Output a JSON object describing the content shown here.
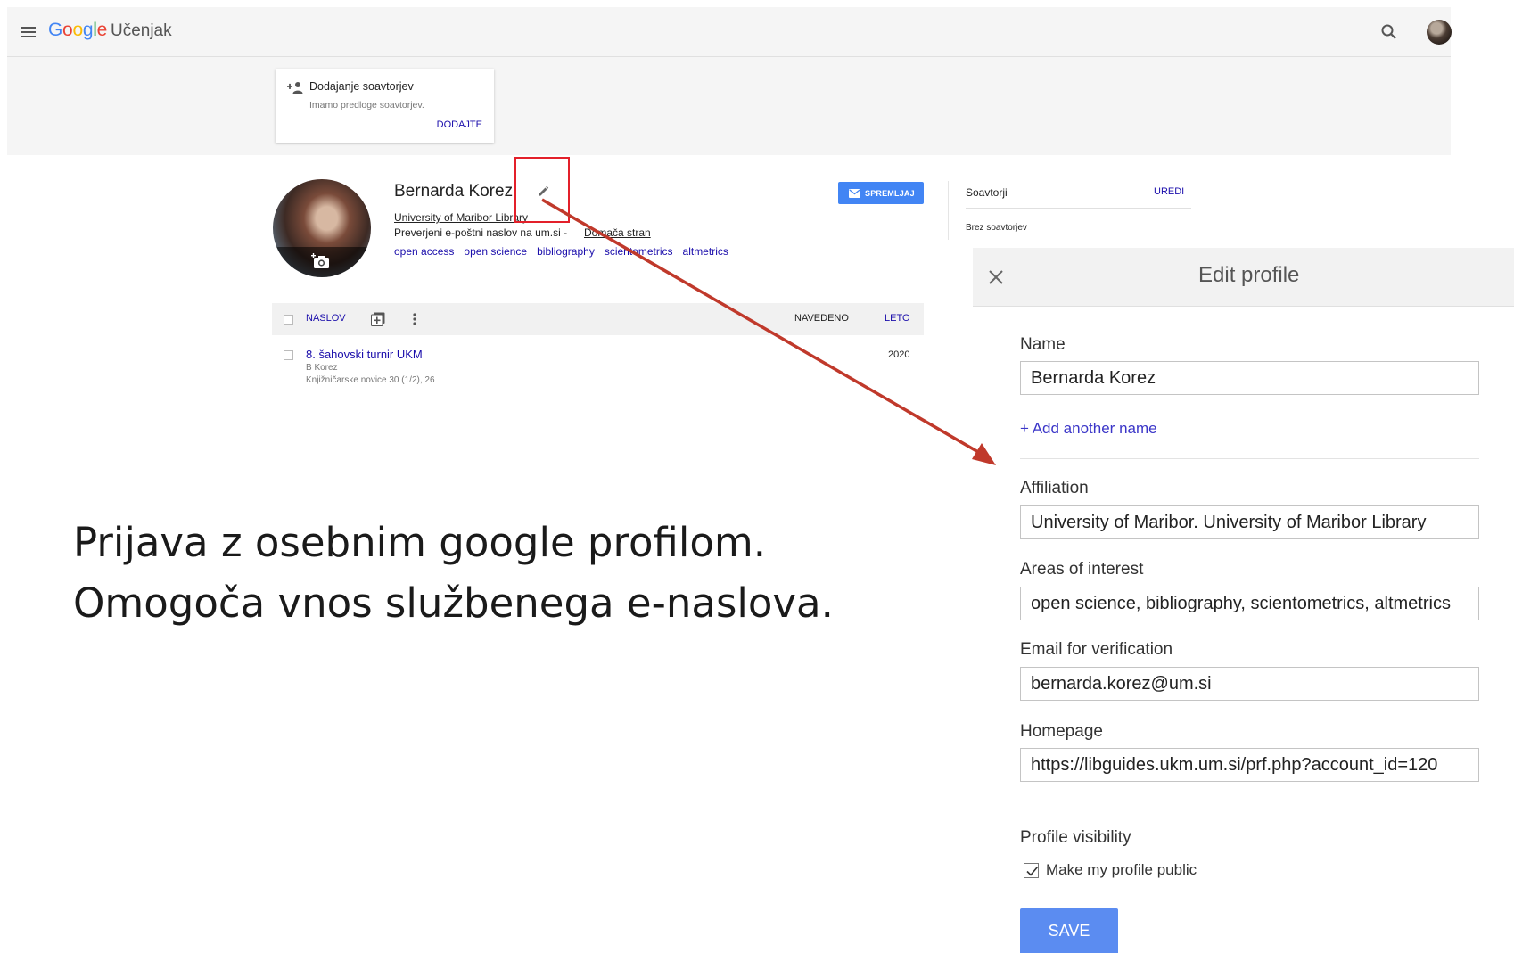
{
  "topbar": {
    "logo_google": [
      "G",
      "o",
      "o",
      "g",
      "l",
      "e"
    ],
    "app_name": "Učenjak",
    "menu_icon": "hamburger-menu-icon",
    "search_icon": "search-icon",
    "account_icon": "account-avatar"
  },
  "coauthor_card": {
    "icon": "add-person-icon",
    "title": "Dodajanje soavtorjev",
    "subtitle": "Imamo predloge soavtorjev.",
    "action": "DODAJTE"
  },
  "profile": {
    "name": "Bernarda Korez",
    "affiliation": "University of Maribor Library",
    "verified_email": "Preverjeni e-poštni naslov na um.si - ",
    "homepage_link": "Domača stran",
    "interests": [
      "open access",
      "open science",
      "bibliography",
      "scientometrics",
      "altmetrics"
    ],
    "follow_label": "SPREMLJAJ"
  },
  "coauthors": {
    "title": "Soavtorji",
    "edit_label": "UREDI",
    "empty_text": "Brez soavtorjev"
  },
  "articles": {
    "columns": {
      "title": "NASLOV",
      "cited": "NAVEDENO",
      "year": "LETO"
    },
    "rows": [
      {
        "title": "8. šahovski turnir UKM",
        "authors": "B Korez",
        "source": "Knjižničarske novice 30 (1/2), 26",
        "year": "2020"
      }
    ]
  },
  "caption": {
    "line1": "Prijava z osebnim google profilom.",
    "line2": "Omogoča vnos službenega e-naslova."
  },
  "edit_profile": {
    "title": "Edit profile",
    "name_label": "Name",
    "name_value": "Bernarda Korez",
    "add_name": "+ Add another name",
    "affiliation_label": "Affiliation",
    "affiliation_value": "University of Maribor. University of Maribor Library",
    "interests_label": "Areas of interest",
    "interests_value": "open science, bibliography, scientometrics, altmetrics",
    "email_label": "Email for verification",
    "email_value": "bernarda.korez@um.si",
    "homepage_label": "Homepage",
    "homepage_value": "https://libguides.ukm.um.si/prf.php?account_id=120",
    "visibility_label": "Profile visibility",
    "public_label": "Make my profile public",
    "public_checked": true,
    "save_label": "SAVE"
  },
  "colors": {
    "link": "#1a0dab",
    "primary_button": "#4285f4",
    "save_button": "#5b8cf1",
    "highlight": "#e3202a",
    "arrow": "#c0392b"
  }
}
